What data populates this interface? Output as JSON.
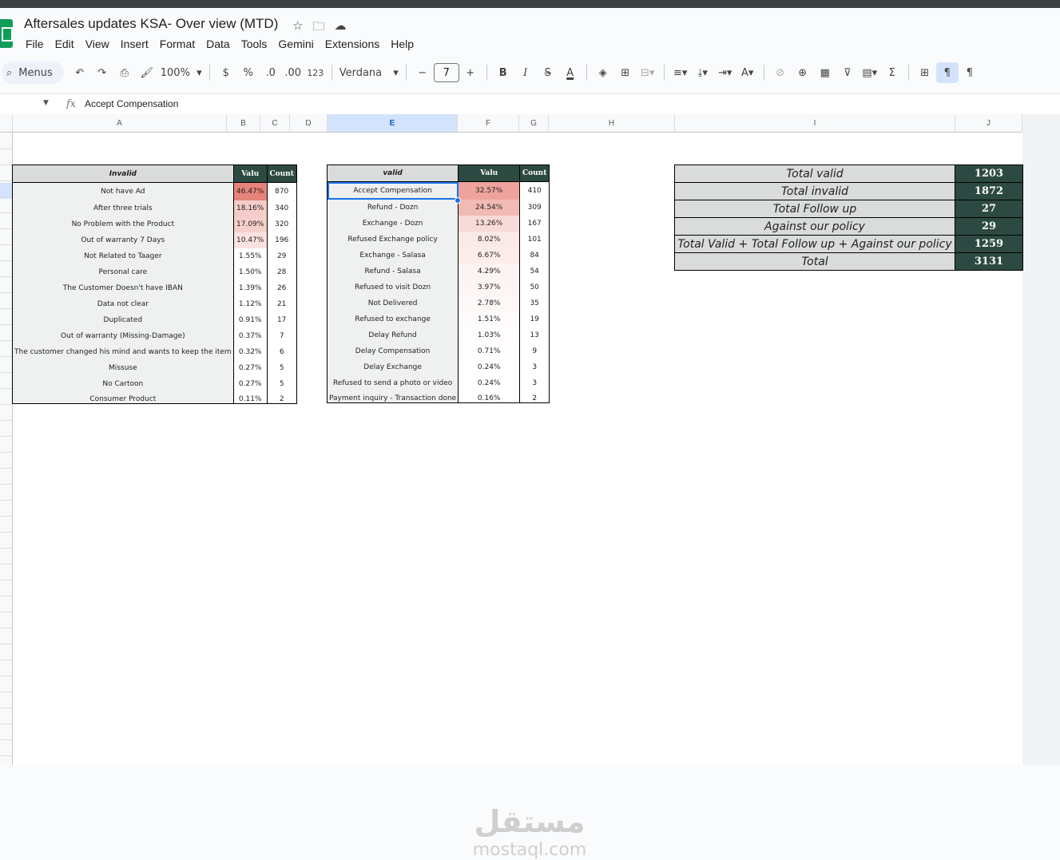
{
  "app": {
    "title": "Aftersales updates KSA- Over view (MTD)"
  },
  "menu": [
    "File",
    "Edit",
    "View",
    "Insert",
    "Format",
    "Data",
    "Tools",
    "Gemini",
    "Extensions",
    "Help"
  ],
  "toolbar": {
    "menus_label": "Menus",
    "zoom": "100%",
    "currency": "$",
    "percent": "%",
    "dec_decrease": ".0",
    "dec_increase": ".00",
    "number_format": "123",
    "font": "Verdana",
    "font_size": "7",
    "minus": "−",
    "plus": "+"
  },
  "formula": {
    "fx": "fx",
    "content": "Accept Compensation"
  },
  "columns": [
    "A",
    "B",
    "C",
    "D",
    "E",
    "F",
    "G",
    "H",
    "I",
    "J"
  ],
  "invalid_table": {
    "header": {
      "label": "Invalid",
      "value": "Valu",
      "count": "Count"
    },
    "rows": [
      {
        "label": "Not have Ad",
        "value": "46.47%",
        "count": "870",
        "heat": 0.95
      },
      {
        "label": "After three trials",
        "value": "18.16%",
        "count": "340",
        "heat": 0.39
      },
      {
        "label": "No Problem with the Product",
        "value": "17.09%",
        "count": "320",
        "heat": 0.37
      },
      {
        "label": "Out of warranty 7 Days",
        "value": "10.47%",
        "count": "196",
        "heat": 0.22
      },
      {
        "label": "Not Related to Taager",
        "value": "1.55%",
        "count": "29",
        "heat": 0
      },
      {
        "label": "Personal care",
        "value": "1.50%",
        "count": "28",
        "heat": 0
      },
      {
        "label": "The Customer Doesn't have IBAN",
        "value": "1.39%",
        "count": "26",
        "heat": 0
      },
      {
        "label": "Data not clear",
        "value": "1.12%",
        "count": "21",
        "heat": 0
      },
      {
        "label": "Duplicated",
        "value": "0.91%",
        "count": "17",
        "heat": 0
      },
      {
        "label": "Out of warranty (Missing-Damage)",
        "value": "0.37%",
        "count": "7",
        "heat": 0
      },
      {
        "label": "The customer changed his mind and wants to keep the item",
        "value": "0.32%",
        "count": "6",
        "heat": 0
      },
      {
        "label": "Missuse",
        "value": "0.27%",
        "count": "5",
        "heat": 0
      },
      {
        "label": "No Cartoon",
        "value": "0.27%",
        "count": "5",
        "heat": 0
      },
      {
        "label": "Consumer Product",
        "value": "0.11%",
        "count": "2",
        "heat": 0
      }
    ]
  },
  "valid_table": {
    "header": {
      "label": "valid",
      "value": "Valu",
      "count": "Count"
    },
    "rows": [
      {
        "label": "Accept Compensation",
        "value": "32.57%",
        "count": "410",
        "heat": 0.7
      },
      {
        "label": "Refund - Dozn",
        "value": "24.54%",
        "count": "309",
        "heat": 0.53
      },
      {
        "label": "Exchange - Dozn",
        "value": "13.26%",
        "count": "167",
        "heat": 0.28
      },
      {
        "label": "Refused Exchange policy",
        "value": "8.02%",
        "count": "101",
        "heat": 0.17
      },
      {
        "label": "Exchange - Salasa",
        "value": "6.67%",
        "count": "84",
        "heat": 0.14
      },
      {
        "label": "Refund - Salasa",
        "value": "4.29%",
        "count": "54",
        "heat": 0.09
      },
      {
        "label": "Refused to visit Dozn",
        "value": "3.97%",
        "count": "50",
        "heat": 0.08
      },
      {
        "label": "Not Delivered",
        "value": "2.78%",
        "count": "35",
        "heat": 0.06
      },
      {
        "label": "Refused to exchange",
        "value": "1.51%",
        "count": "19",
        "heat": 0.03
      },
      {
        "label": "Delay Refund",
        "value": "1.03%",
        "count": "13",
        "heat": 0.02
      },
      {
        "label": "Delay Compensation",
        "value": "0.71%",
        "count": "9",
        "heat": 0.01
      },
      {
        "label": "Delay Exchange",
        "value": "0.24%",
        "count": "3",
        "heat": 0
      },
      {
        "label": "Refused to send a photo or video",
        "value": "0.24%",
        "count": "3",
        "heat": 0
      },
      {
        "label": "Payment inquiry - Transaction done",
        "value": "0.16%",
        "count": "2",
        "heat": 0
      }
    ]
  },
  "summary": [
    {
      "label": "Total valid",
      "value": "1203"
    },
    {
      "label": "Total invalid",
      "value": "1872"
    },
    {
      "label": "Total Follow up",
      "value": "27"
    },
    {
      "label": "Against our policy",
      "value": "29"
    },
    {
      "label": "Total Valid + Total Follow up + Against our policy",
      "value": "1259"
    },
    {
      "label": "Total",
      "value": "3131"
    }
  ],
  "watermark": {
    "arabic": "مستقل",
    "latin": "mostaql.com"
  },
  "colors": {
    "heat_max": "#e67c73",
    "header_dark": "#2d4a42",
    "header_light": "#d9dcdb",
    "selection": "#1a73e8"
  }
}
